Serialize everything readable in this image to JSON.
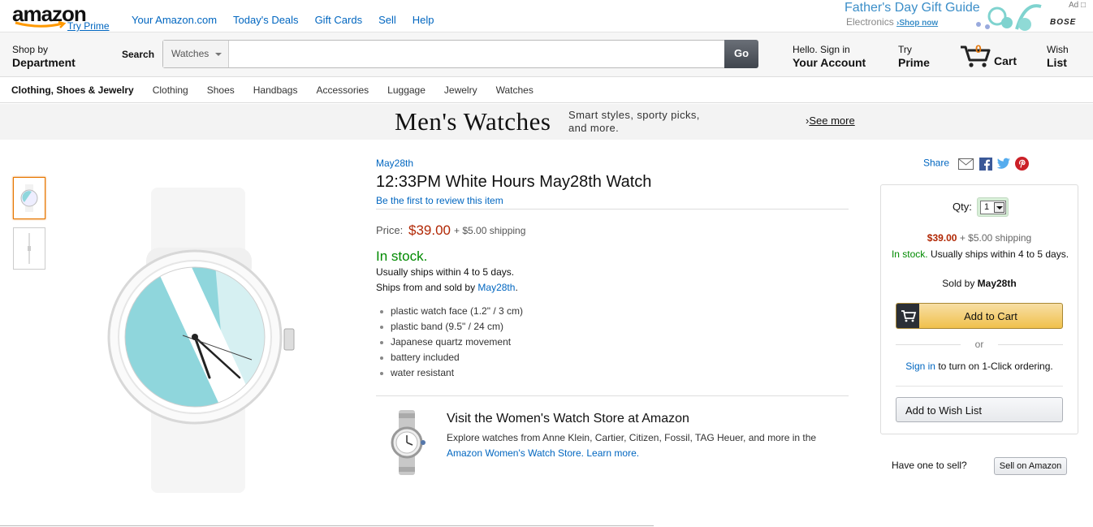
{
  "header": {
    "logo_text": "amazon",
    "try_prime": "Try Prime",
    "links": [
      "Your Amazon.com",
      "Today's Deals",
      "Gift Cards",
      "Sell",
      "Help"
    ],
    "ad": {
      "title": "Father's Day Gift Guide",
      "subtitle": "Electronics",
      "shop_now": "›Shop now",
      "ad_label": "Ad",
      "brand": "BOSE"
    }
  },
  "nav": {
    "shop_by": "Shop by",
    "department": "Department",
    "search_label": "Search",
    "search_category": "Watches",
    "search_value": "",
    "go_label": "Go",
    "account_line1": "Hello. Sign in",
    "account_line2": "Your Account",
    "prime_line1": "Try",
    "prime_line2": "Prime",
    "cart_count": "0",
    "cart_label": "Cart",
    "wish_line1": "Wish",
    "wish_line2": "List"
  },
  "subnav": {
    "first": "Clothing, Shoes & Jewelry",
    "items": [
      "Clothing",
      "Shoes",
      "Handbags",
      "Accessories",
      "Luggage",
      "Jewelry",
      "Watches"
    ]
  },
  "banner": {
    "title": "Men's Watches",
    "subtitle": "Smart styles, sporty picks, and more.",
    "see_more": "See more"
  },
  "product": {
    "brand": "May28th",
    "title": "12:33PM White Hours May28th Watch",
    "review_link": "Be the first to review this item",
    "price_label": "Price:",
    "price": "$39.00",
    "shipping": "+ $5.00 shipping",
    "in_stock": "In stock.",
    "ships_within": "Usually ships within 4 to 5 days.",
    "sold_by_prefix": "Ships from and sold by ",
    "sold_by": "May28th",
    "bullets": [
      "plastic watch face (1.2\" / 3 cm)",
      "plastic band (9.5\" / 24 cm)",
      "Japanese quartz movement",
      "battery included",
      "water resistant"
    ]
  },
  "promo": {
    "title": "Visit the Women's Watch Store at Amazon",
    "text": "Explore watches from Anne Klein, Cartier, Citizen, Fossil, TAG Heuer, and more in the ",
    "link": "Amazon Women's Watch Store.",
    "learn_more": "Learn more."
  },
  "share": {
    "label": "Share"
  },
  "buybox": {
    "qty_label": "Qty:",
    "qty_value": "1",
    "price": "$39.00",
    "shipping": "+ $5.00 shipping",
    "in_stock": "In stock.",
    "ships_within": "Usually ships within 4 to 5 days.",
    "sold_by_prefix": "Sold by ",
    "sold_by": "May28th",
    "add_to_cart": "Add to Cart",
    "or": "or",
    "sign_in": "Sign in",
    "one_click": " to turn on 1-Click ordering.",
    "add_to_wish_list": "Add to Wish List"
  },
  "sell": {
    "question": "Have one to sell?",
    "button": "Sell on Amazon"
  },
  "colors": {
    "link": "#0066c0",
    "price": "#b12704",
    "stock": "#008a00",
    "cart_button": "#f0c14b",
    "watch_accent": "#8fd6dc"
  }
}
